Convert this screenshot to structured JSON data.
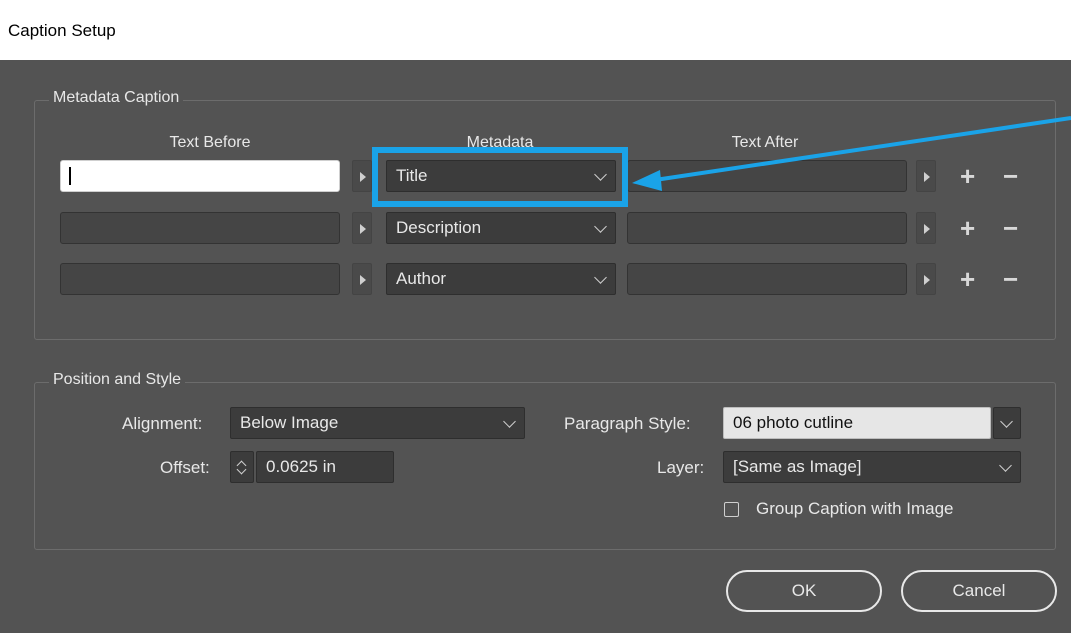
{
  "window": {
    "title": "Caption Setup"
  },
  "metadata_caption": {
    "group_title": "Metadata Caption",
    "columns": {
      "text_before": "Text Before",
      "metadata": "Metadata",
      "text_after": "Text After"
    },
    "rows": [
      {
        "text_before": "",
        "metadata": "Title",
        "text_after": ""
      },
      {
        "text_before": "",
        "metadata": "Description",
        "text_after": ""
      },
      {
        "text_before": "",
        "metadata": "Author",
        "text_after": ""
      }
    ],
    "add_glyph": "+",
    "remove_glyph": "−"
  },
  "position_style": {
    "group_title": "Position and Style",
    "alignment_label": "Alignment:",
    "alignment_value": "Below Image",
    "offset_label": "Offset:",
    "offset_value": "0.0625 in",
    "paragraph_style_label": "Paragraph Style:",
    "paragraph_style_value": "06 photo cutline",
    "layer_label": "Layer:",
    "layer_value": "[Same as Image]",
    "group_caption_label": "Group Caption with Image",
    "group_caption_checked": false
  },
  "buttons": {
    "ok": "OK",
    "cancel": "Cancel"
  },
  "annotation": {
    "highlight_color": "#1aa3e8",
    "points_to": "Title"
  },
  "icons": [
    "chevron-down-icon",
    "play-arrow-icon",
    "plus-icon",
    "minus-icon",
    "spinner-icon",
    "checkbox-icon"
  ]
}
